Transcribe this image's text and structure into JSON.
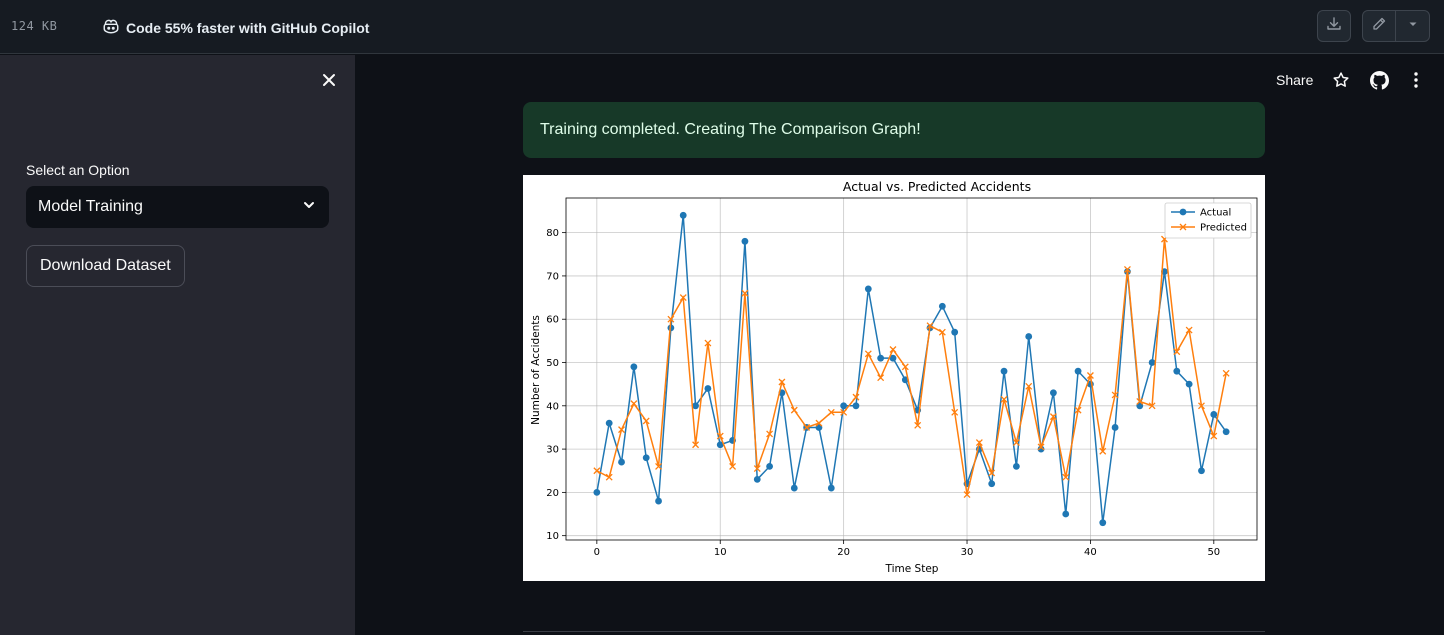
{
  "topbar": {
    "file_size": "124 KB",
    "copilot_text": "Code 55% faster with GitHub Copilot"
  },
  "sidebar": {
    "select_label": "Select an Option",
    "selected_option": "Model Training",
    "download_button": "Download Dataset"
  },
  "header": {
    "share_label": "Share"
  },
  "alert": {
    "message": "Training completed. Creating The Comparison Graph!"
  },
  "chart_data": {
    "type": "line",
    "title": "Actual vs. Predicted Accidents",
    "xlabel": "Time Step",
    "ylabel": "Number of Accidents",
    "xlim": [
      -2.5,
      53.5
    ],
    "ylim": [
      9,
      88
    ],
    "xticks": [
      0,
      10,
      20,
      30,
      40,
      50
    ],
    "yticks": [
      10,
      20,
      30,
      40,
      50,
      60,
      70,
      80
    ],
    "grid": true,
    "legend_position": "top-right",
    "series": [
      {
        "name": "Actual",
        "color": "#1f77b4",
        "marker": "circle",
        "values": [
          20,
          36,
          27,
          49,
          28,
          18,
          58,
          84,
          40,
          44,
          31,
          32,
          78,
          23,
          26,
          43,
          21,
          35,
          35,
          21,
          40,
          40,
          67,
          51,
          51,
          46,
          39,
          58,
          63,
          57,
          22,
          30,
          22,
          48,
          26,
          56,
          30,
          43,
          15,
          48,
          45,
          13,
          35,
          71,
          40,
          50,
          71,
          48,
          45,
          25,
          38,
          34
        ]
      },
      {
        "name": "Predicted",
        "color": "#ff7f0e",
        "marker": "x",
        "values": [
          25,
          23.5,
          34.5,
          40.5,
          36.5,
          26,
          60,
          65,
          31,
          54.5,
          33,
          26,
          66,
          25.5,
          33.5,
          45.5,
          39,
          35,
          36,
          38.5,
          38.5,
          42,
          52,
          46.5,
          53,
          49,
          35.5,
          58.5,
          57,
          38.5,
          19.5,
          31.5,
          24.5,
          41.5,
          31.5,
          44.5,
          30.5,
          37.5,
          23.5,
          39,
          47,
          29.5,
          42.5,
          71.5,
          41,
          40,
          78.5,
          52.5,
          57.5,
          40,
          33,
          47.5
        ]
      }
    ]
  }
}
